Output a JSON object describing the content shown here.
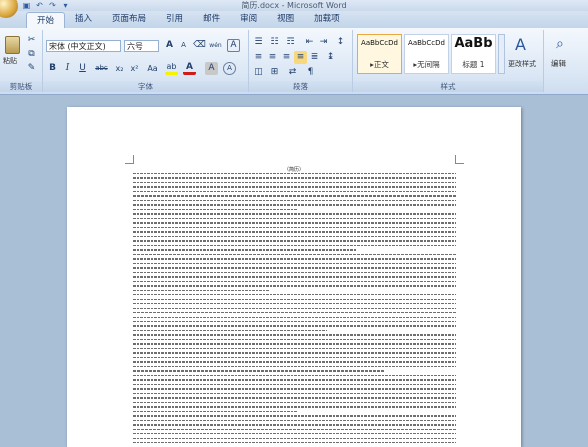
{
  "window": {
    "title": "简历.docx - Microsoft Word"
  },
  "tabs": [
    "开始",
    "插入",
    "页面布局",
    "引用",
    "邮件",
    "审阅",
    "视图",
    "加载项"
  ],
  "clipboard": {
    "paste": "粘贴",
    "group_label": "剪贴板"
  },
  "font": {
    "name": "宋体 (中文正文)",
    "size": "六号",
    "group_label": "字体",
    "grow": "A",
    "shrink": "A",
    "clear": "⌫",
    "phonetic": "wén",
    "border_char": "A",
    "bold": "B",
    "italic": "I",
    "underline": "U",
    "strike": "abc",
    "sub": "x₂",
    "sup": "x²",
    "case": "Aa",
    "highlight": "ab",
    "color": "A",
    "char_shade": "A",
    "enclose": "A"
  },
  "paragraph": {
    "group_label": "段落"
  },
  "styles": {
    "group_label": "样式",
    "items": [
      {
        "preview": "AaBbCcDd",
        "name": "▸正文"
      },
      {
        "preview": "AaBbCcDd",
        "name": "▸无间隔"
      },
      {
        "preview": "AaBb",
        "name": "标题 1"
      }
    ],
    "change": "更改样式"
  },
  "editing": {
    "label": "编辑"
  },
  "document": {
    "title": "（简历）",
    "lines": 62,
    "accent": "#2b579a"
  }
}
